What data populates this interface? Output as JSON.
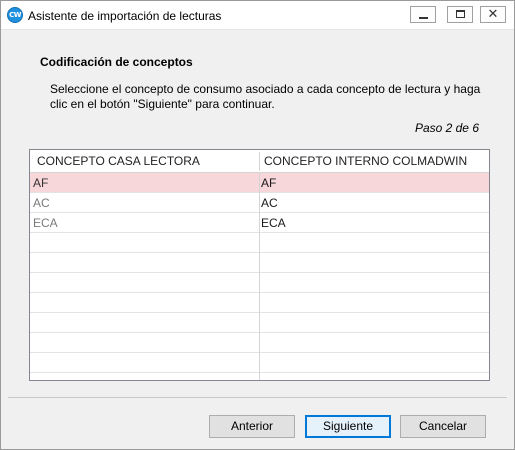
{
  "window": {
    "title": "Asistente de importación de lecturas",
    "icon_text": "CW",
    "icon": "colmadwin-app-icon"
  },
  "header": {
    "section_title": "Codificación de conceptos",
    "description": "Seleccione el concepto de consumo asociado a cada concepto de lectura y haga clic en el botón \"Siguiente\" para continuar.",
    "step": "Paso 2 de 6"
  },
  "grid": {
    "columns": [
      "CONCEPTO CASA LECTORA",
      "CONCEPTO INTERNO COLMADWIN"
    ],
    "rows": [
      {
        "casa": "AF",
        "interno": "AF",
        "selected": true
      },
      {
        "casa": "AC",
        "interno": "AC",
        "selected": false
      },
      {
        "casa": "ECA",
        "interno": "ECA",
        "selected": false
      },
      {
        "casa": "",
        "interno": "",
        "selected": false
      },
      {
        "casa": "",
        "interno": "",
        "selected": false
      },
      {
        "casa": "",
        "interno": "",
        "selected": false
      },
      {
        "casa": "",
        "interno": "",
        "selected": false
      },
      {
        "casa": "",
        "interno": "",
        "selected": false
      },
      {
        "casa": "",
        "interno": "",
        "selected": false
      },
      {
        "casa": "",
        "interno": "",
        "selected": false
      }
    ],
    "selected_color": "#f8d7da"
  },
  "buttons": {
    "previous": "Anterior",
    "next": "Siguiente",
    "cancel": "Cancelar"
  },
  "colors": {
    "accent": "#0078d7",
    "window_bg": "#f0f0f0"
  }
}
